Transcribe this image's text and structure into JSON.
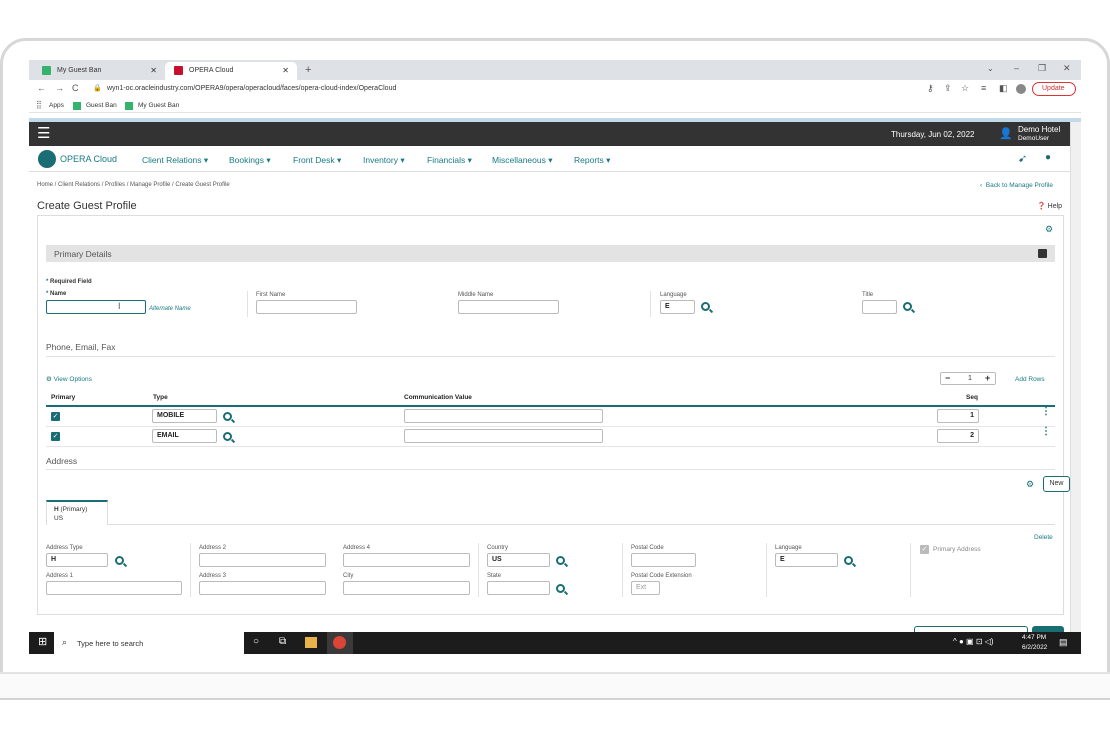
{
  "browser": {
    "tabs": [
      {
        "label": "My Guest Ban"
      },
      {
        "label": "OPERA Cloud"
      }
    ],
    "url": "wyn1-oc.oracleindustry.com/OPERA9/opera/operacloud/faces/opera-cloud-index/OperaCloud",
    "update_label": "Update",
    "bookmarks": [
      "Apps",
      "Guest Ban",
      "My Guest Ban"
    ]
  },
  "header": {
    "date": "Thursday, Jun 02, 2022",
    "hotel": "Demo Hotel",
    "user": "DemoUser"
  },
  "nav": {
    "logo": "OPERA Cloud",
    "items": [
      "Client Relations",
      "Bookings",
      "Front Desk",
      "Inventory",
      "Financials",
      "Miscellaneous",
      "Reports"
    ]
  },
  "breadcrumb": "Home / Client Relations / Profiles / Manage Profile / Create Guest Profile",
  "back_link": "Back to Manage Profile",
  "page_title": "Create Guest Profile",
  "help": "Help",
  "primary": {
    "section_title": "Primary Details",
    "required_note": "Required Field",
    "name_label": "Name",
    "alt_name": "Alternate Name",
    "first_name": "First Name",
    "middle_name": "Middle Name",
    "language_label": "Language",
    "language_value": "E",
    "title_label": "Title"
  },
  "phone": {
    "section_title": "Phone, Email, Fax",
    "view_options": "View Options",
    "row_count": "1",
    "add_rows": "Add Rows",
    "columns": [
      "Primary",
      "Type",
      "Communication Value",
      "Seq"
    ],
    "rows": [
      {
        "type": "MOBILE",
        "seq": "1"
      },
      {
        "type": "EMAIL",
        "seq": "2"
      }
    ]
  },
  "address": {
    "section_title": "Address",
    "new_label": "New",
    "tab_title": "H",
    "tab_sub": "(Primary)",
    "tab_country": "US",
    "delete": "Delete",
    "type_label": "Address Type",
    "type_value": "H",
    "addr1": "Address 1",
    "addr2": "Address 2",
    "addr3": "Address 3",
    "addr4": "Address 4",
    "city": "City",
    "country_label": "Country",
    "country_value": "US",
    "state": "State",
    "postal": "Postal Code",
    "postal_ext": "Postal Code Extension",
    "ext_placeholder": "Ext",
    "lang_label": "Language",
    "lang_value": "E",
    "primary_addr": "Primary Address"
  },
  "taskbar": {
    "search": "Type here to search",
    "time": "4:47 PM",
    "date": "6/2/2022"
  }
}
